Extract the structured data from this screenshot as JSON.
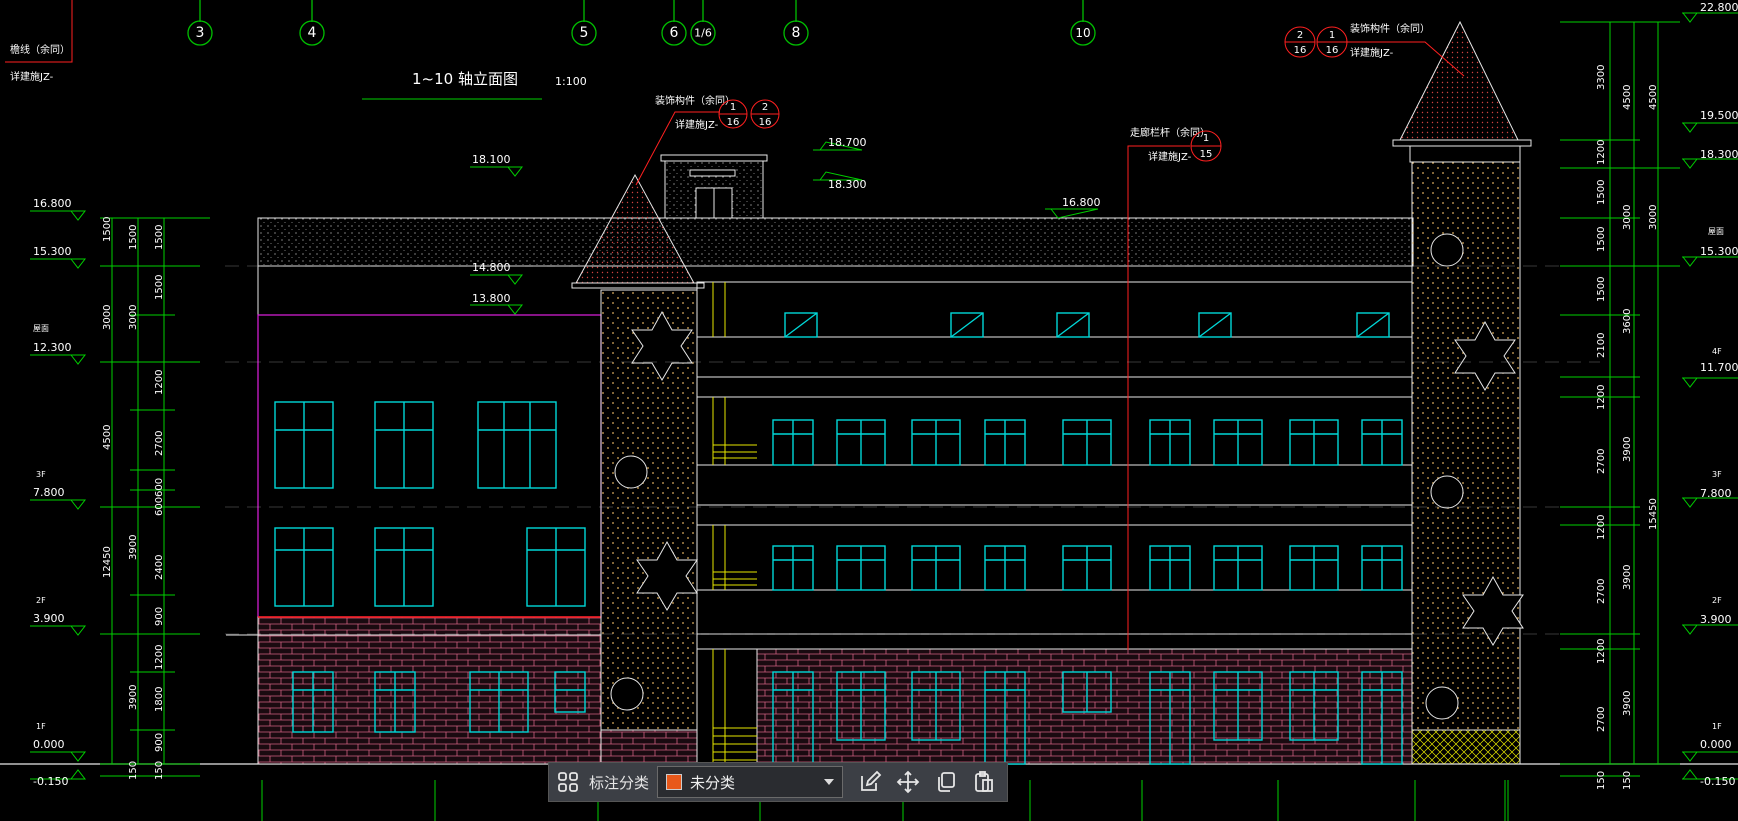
{
  "drawing": {
    "title": "1~10 轴立面图",
    "scale": "1:100",
    "grid_labels": [
      "3",
      "4",
      "5",
      "6",
      "1/6",
      "8",
      "10"
    ],
    "callouts": {
      "top_left_a": "檐线（余同）",
      "top_left_b": "详建施JZ-",
      "center_a": "装饰构件（余同）",
      "center_b": "详建施JZ-",
      "center_num1": "1",
      "center_den1": "16",
      "center_num2": "2",
      "center_den2": "16",
      "mid_a": "走廊栏杆（余同）",
      "mid_b": "详建施JZ-",
      "mid_num": "1",
      "mid_den": "15",
      "right_a": "装饰构件（余同）",
      "right_b": "详建施JZ-",
      "right_num1": "2",
      "right_den1": "16",
      "right_num2": "1",
      "right_den2": "16"
    },
    "elevations_left": [
      "16.800",
      "15.300",
      "12.300",
      "7.800",
      "3.900",
      "0.000",
      "-0.150"
    ],
    "floor_tags_left": [
      "屋面",
      "3F",
      "2F",
      "1F"
    ],
    "elevations_center": [
      "18.100",
      "14.800",
      "13.800",
      "18.700",
      "18.300",
      "16.800"
    ],
    "elevations_right": [
      "22.800",
      "19.500",
      "18.300",
      "15.300",
      "11.700",
      "7.800",
      "3.900",
      "0.000",
      "-0.150"
    ],
    "floor_tags_right": [
      "屋面",
      "4F",
      "3F",
      "2F",
      "1F"
    ],
    "dims_left_outer": [
      "1500",
      "3000",
      "4500",
      "12450",
      "3900",
      "150"
    ],
    "dims_left_inner": [
      "1500",
      "1500",
      "1500",
      "3000",
      "1200",
      "2700",
      "600",
      "600",
      "2400",
      "900",
      "1200",
      "1800",
      "900",
      "3900",
      "150"
    ],
    "dims_right_inner": [
      "3300",
      "1200",
      "1500",
      "1500",
      "1500",
      "2100",
      "1200",
      "2700",
      "1200",
      "2700",
      "1200",
      "2700",
      "150"
    ],
    "dims_right_mid": [
      "4500",
      "3000",
      "3600",
      "3900",
      "3900",
      "3900",
      "150"
    ],
    "dims_right_outer": [
      "4500",
      "3000",
      "15450"
    ]
  },
  "toolbar": {
    "label": "标注分类",
    "category_value": "未分类",
    "category_color": "#e8581a"
  }
}
